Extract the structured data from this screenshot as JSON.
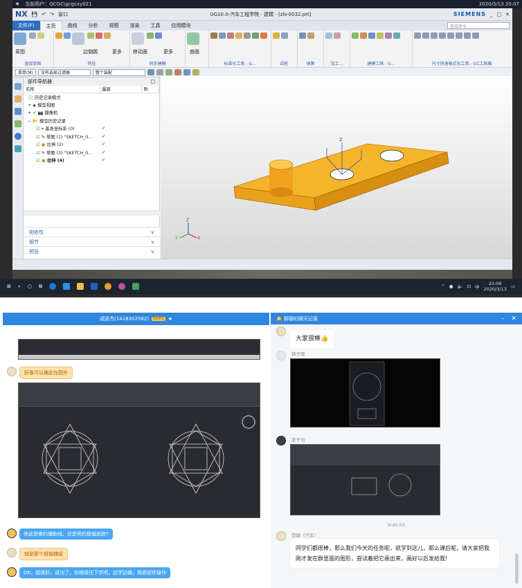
{
  "remote_bar": {
    "user": "当前用户：QCGC\\gcgcxy021",
    "datetime": "2020/3/13 20:07"
  },
  "nx": {
    "logo": "NX",
    "title": "UG10.0-汽车工程学院 - 建模 - [zls-0032.prt]",
    "brand": "SIEMENS",
    "window_label": "窗口",
    "menu": [
      "文件(F)",
      "主页",
      "曲线",
      "分析",
      "视图",
      "渲染",
      "工具",
      "应用模块"
    ],
    "search_placeholder": "查找命令",
    "ribbon_groups": [
      "直接草图",
      "特征",
      "同步建模",
      "标准化工具 - G...",
      "齿轮",
      "弹簧",
      "加工...",
      "建模工具 - G...",
      "尺寸快速格式化工具 - GC工具箱"
    ],
    "ribbon_buttons": [
      "草图",
      "边倒圆",
      "更多",
      "移动面",
      "更多",
      "曲面"
    ],
    "selbar": {
      "menu_label": "菜单(M)",
      "filter": "没有选择过滤器",
      "assembly": "整个装配"
    },
    "navigator": {
      "title": "部件导航器",
      "columns": [
        "名称",
        "最新",
        "附"
      ],
      "rows": [
        {
          "name": "历史记录模式",
          "latest": ""
        },
        {
          "name": "模型视图",
          "latest": ""
        },
        {
          "name": "摄像机",
          "latest": ""
        },
        {
          "name": "模型历史记录",
          "latest": ""
        },
        {
          "name": "基准坐标系 (0)",
          "latest": "✔"
        },
        {
          "name": "草图 (1) \"SKETCH_0...",
          "latest": "✔"
        },
        {
          "name": "拉伸 (2)",
          "latest": "✔"
        },
        {
          "name": "草图 (3) \"SKETCH_0...",
          "latest": "✔"
        },
        {
          "name": "拉伸 (4)",
          "latest": "✔"
        }
      ],
      "panels": [
        "相依性",
        "细节",
        "预览"
      ]
    },
    "axis_labels": {
      "z": "Z",
      "y": "Y",
      "x": "X"
    }
  },
  "taskbar": {
    "time": "20:09",
    "date": "2020/3/13"
  },
  "left_chat": {
    "title": "成凯杰(1418302582)",
    "badge": "SVIP2",
    "messages": [
      {
        "text": "好像可以确定在圆外",
        "style": "yellow"
      },
      {
        "text": "你这是做的辅助线，还是用的极轴追踪?",
        "style": "blue"
      },
      {
        "text": "就是那个极轴捕捉",
        "style": "yellow"
      },
      {
        "text": "OK，挺很好，成功了，你继续往下学吧，边学边做，熟悉软件操作",
        "style": "blue"
      }
    ]
  },
  "right_chat": {
    "title": "群聊的聊天记录",
    "msg1": "大家很棒👍",
    "sender2": "韩子雨",
    "sender3": "李子为",
    "timestamp": "9:45:55",
    "sender4": "范毓（汽车）",
    "msg4": "同学们都很棒，那么我们今天的任务呢，就学到这儿，那么课后呢，请大家把我刚才发在群里面的图形，尝试着把它画出来，画好以后发给我!"
  },
  "colors": {
    "qq_blue": "#2e86e0",
    "part_orange": "#f2b020",
    "nx_accent": "#2e6fbf"
  }
}
